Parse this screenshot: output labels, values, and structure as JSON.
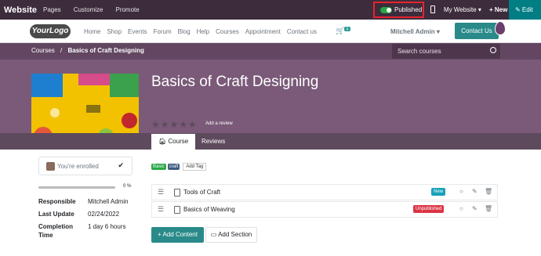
{
  "admin_bar": {
    "brand": "Website",
    "menu": [
      "Pages",
      "Customize",
      "Promote"
    ],
    "published_label": "Published",
    "my_website": "My Website ▾",
    "new_label": "+ New",
    "edit_label": "✎ Edit"
  },
  "site_nav": {
    "logo_text": "YourLogo",
    "links": [
      "Home",
      "Shop",
      "Events",
      "Forum",
      "Blog",
      "Help",
      "Courses",
      "Appointment",
      "Contact us"
    ],
    "cart_count": "1",
    "user_name": "Mitchell Admin ▾",
    "contact_button": "Contact Us"
  },
  "breadcrumb": {
    "parent": "Courses",
    "separator": "/",
    "current": "Basics of Craft Designing"
  },
  "search": {
    "placeholder": "Search courses"
  },
  "course": {
    "title": "Basics of Craft Designing",
    "stars": "★★★★★",
    "add_review": "Add a review"
  },
  "tabs": {
    "course": "Course",
    "reviews": "Reviews"
  },
  "sidebar": {
    "enrolled": "You're enrolled",
    "progress_percent": 0,
    "progress_label": "0 %",
    "info": [
      {
        "key": "Responsible",
        "value": "Mitchell Admin"
      },
      {
        "key": "Last Update",
        "value": "02/24/2022"
      },
      {
        "key": "Completion Time",
        "value": "1 day 6 hours"
      }
    ]
  },
  "tags": [
    {
      "label": "Basic",
      "color": "#28a745"
    },
    {
      "label": "craft",
      "color": "#3d5a80"
    }
  ],
  "add_tag": "Add Tag",
  "lessons": [
    {
      "name": "Tools of Craft",
      "badge": "New",
      "badge_color": "#17a2b8"
    },
    {
      "name": "Basics of Weaving",
      "badge": "Unpublished",
      "badge_color": "#dc3545"
    }
  ],
  "buttons": {
    "add_content": "+ Add Content",
    "add_section": "Add Section"
  },
  "colors": {
    "admin_bar": "#3c2c3c",
    "banner": "#7a5a78",
    "accent": "#2a8a8a",
    "edit": "#017e84"
  }
}
